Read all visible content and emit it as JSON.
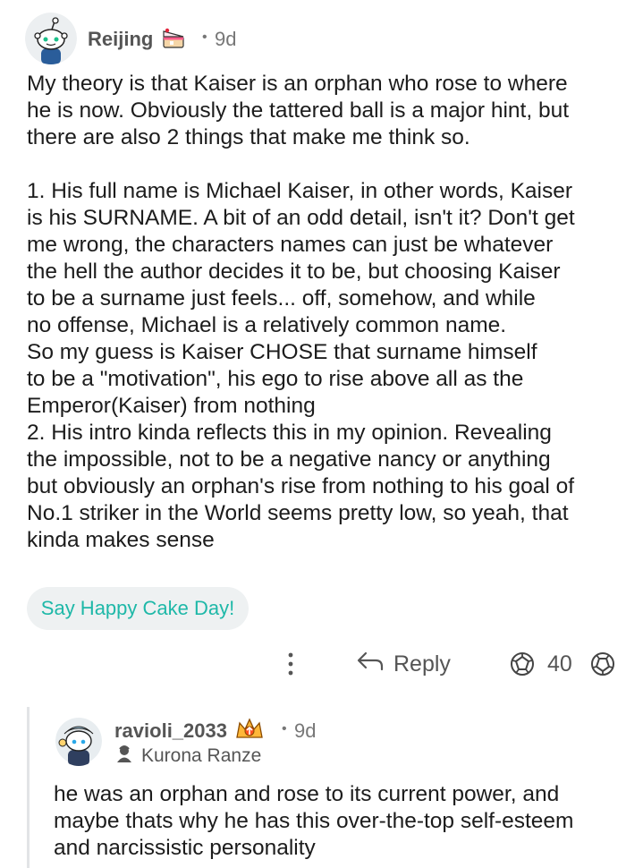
{
  "comment": {
    "username": "Reijing",
    "badge_icon": "cake-day-icon",
    "time_separator": "•",
    "time": "9d",
    "body": "My theory is that Kaiser is an orphan who rose to where\nhe is now. Obviously the tattered ball is a major hint, but\nthere are also 2 things that make me think so.\n\n1. His full name is Michael Kaiser, in other words, Kaiser\nis his SURNAME. A bit of an odd detail, isn't it? Don't get\nme wrong, the characters names can just be whatever\nthe hell the author decides it to be, but choosing Kaiser\nto be a surname just feels... off, somehow, and while\nno offense, Michael is a relatively common name.\nSo my guess is Kaiser CHOSE that surname himself\nto be a \"motivation\", his ego to rise above all as the\nEmperor(Kaiser) from nothing\n2. His intro kinda reflects this in my opinion. Revealing\nthe impossible, not to be a negative nancy or anything\nbut obviously an orphan's rise from nothing to his goal of\nNo.1 striker in the World seems pretty low, so yeah, that\nkinda makes sense",
    "cake_day_label": "Say Happy Cake Day!",
    "actions": {
      "more_icon": "more-vertical-icon",
      "reply_label": "Reply",
      "reply_icon": "reply-arrow-icon",
      "upvote_icon": "upvote-icon",
      "vote_count": "40",
      "downvote_icon": "downvote-icon"
    }
  },
  "reply": {
    "username": "ravioli_2033",
    "badge_icon": "crown-award-icon",
    "time_separator": "•",
    "time": "9d",
    "flair_icon": "flair-avatar-icon",
    "flair": "Kurona Ranze",
    "body": "he was an orphan and rose to its current power, and\nmaybe thats why he has this over-the-top self-esteem\nand narcissistic personality"
  },
  "colors": {
    "accent_teal": "#1eb8a8",
    "cake_btn_bg": "#eef1f2",
    "thread_line": "#e2e4e6",
    "muted_text": "#555555"
  }
}
